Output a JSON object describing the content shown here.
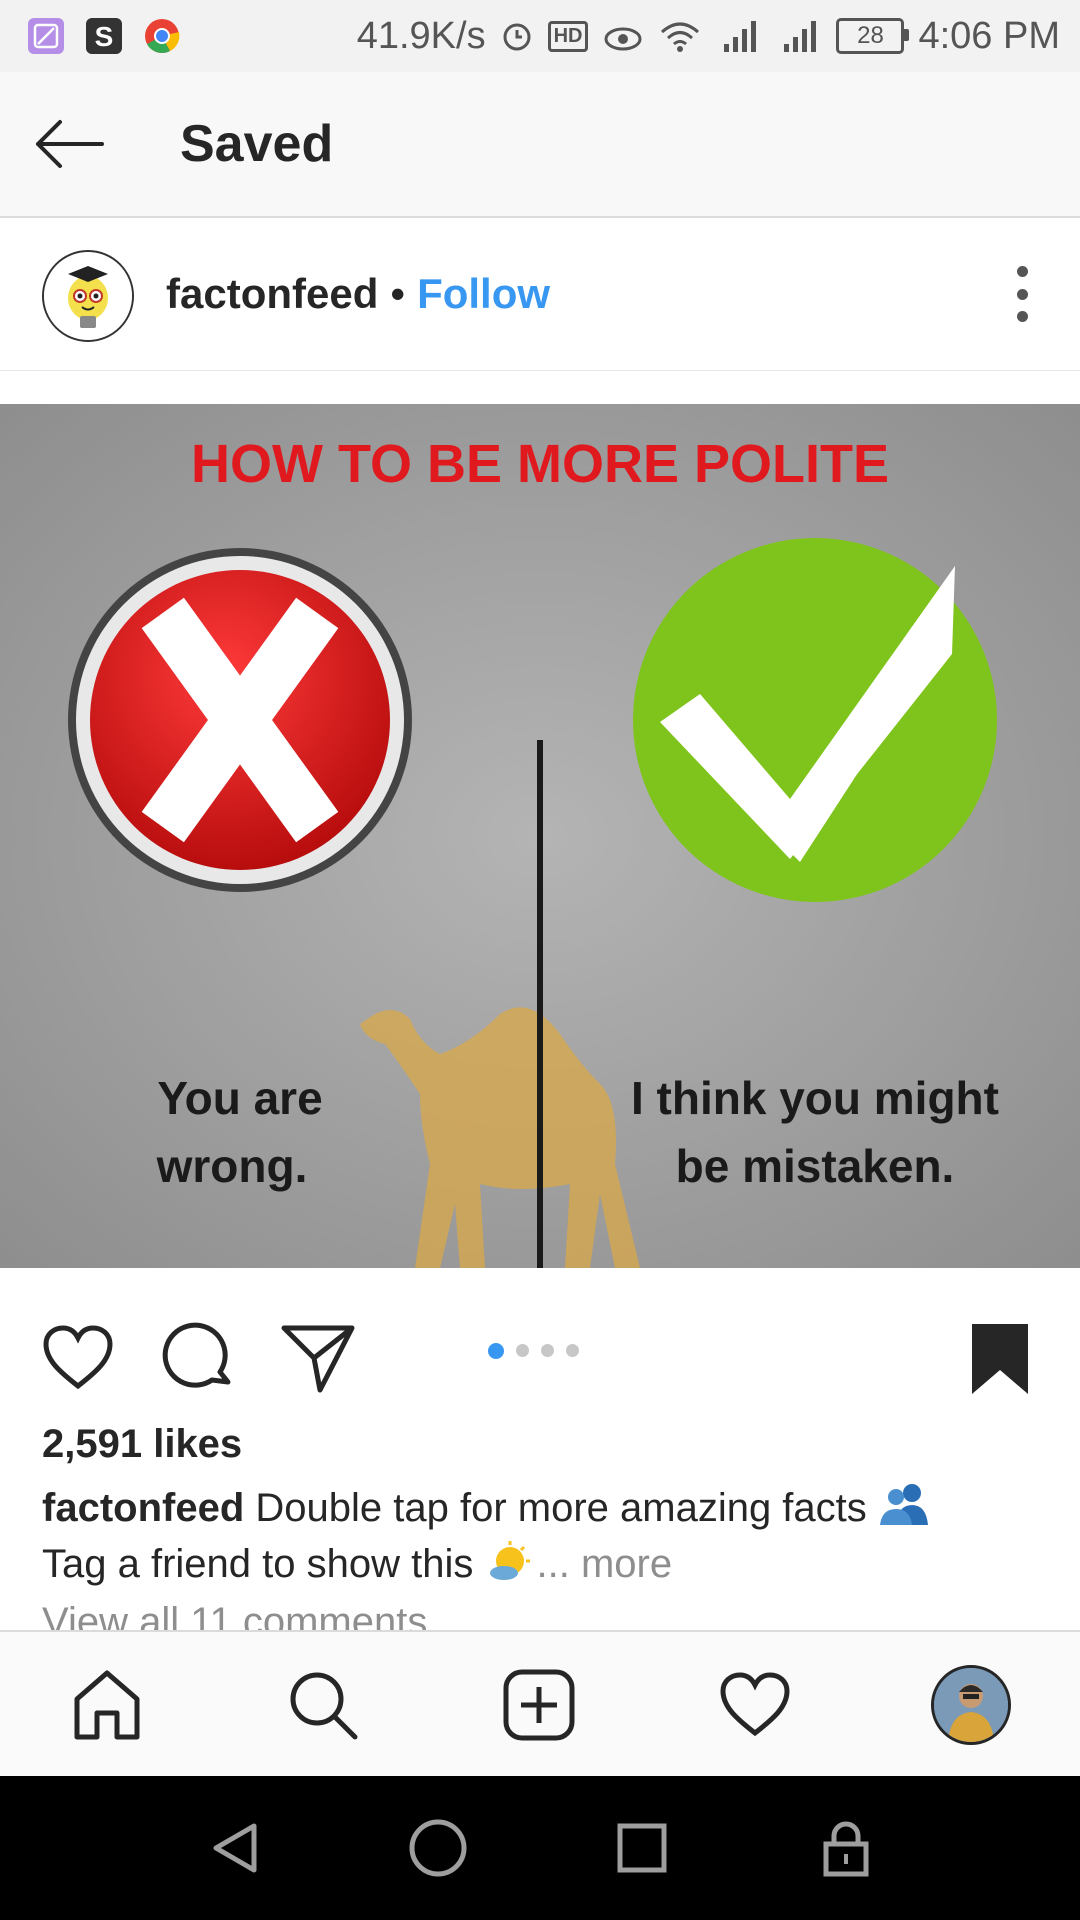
{
  "status_bar": {
    "net_speed": "41.9K/s",
    "hd_label": "HD",
    "battery": "28",
    "time": "4:06 PM",
    "app_icon_colors": [
      "#b58ee8",
      "#333333",
      "#e94235"
    ]
  },
  "header": {
    "title": "Saved"
  },
  "post": {
    "username": "factonfeed",
    "separator": "•",
    "follow_label": "Follow",
    "image": {
      "headline": "HOW TO BE MORE POLITE",
      "left_text_1": "You are",
      "left_text_2": "wrong.",
      "right_text_1": "I think you might",
      "right_text_2": "be mistaken."
    },
    "carousel": {
      "count": 4,
      "active": 1
    },
    "likes": "2,591 likes",
    "caption_user": "factonfeed",
    "caption_line1": "Double tap for more amazing facts",
    "caption_line2": "Tag a friend to show this",
    "caption_more": "... more",
    "view_comments": "View all 11 comments"
  },
  "colors": {
    "accent": "#3897f0",
    "headline_red": "#e0191f",
    "check_green": "#7fc41c",
    "cross_red": "#e21b1b"
  },
  "icons": {
    "actions": [
      "heart-icon",
      "comment-icon",
      "share-icon",
      "bookmark-icon"
    ],
    "bottom_nav": [
      "home-icon",
      "search-icon",
      "add-post-icon",
      "activity-heart-icon",
      "profile-avatar"
    ],
    "system_nav": [
      "back-triangle-icon",
      "home-circle-icon",
      "recents-square-icon",
      "lock-icon"
    ]
  }
}
